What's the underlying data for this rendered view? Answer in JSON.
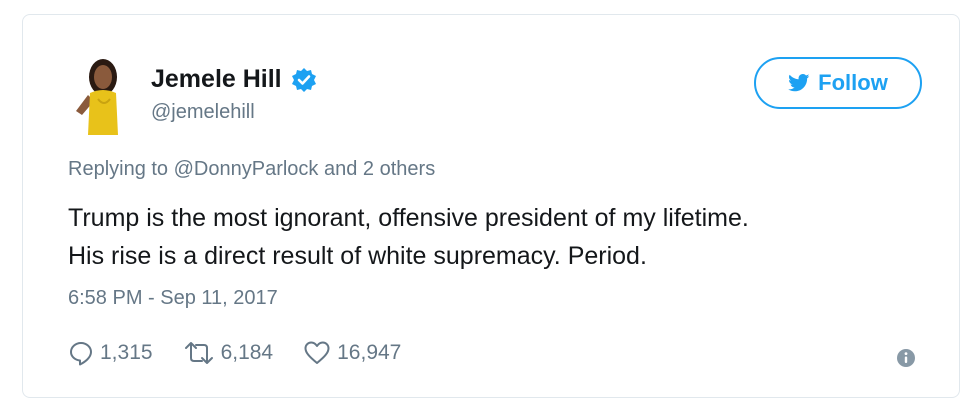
{
  "user": {
    "display_name": "Jemele Hill",
    "handle": "@jemelehill",
    "verified_icon": "verified-badge-icon"
  },
  "follow_button": {
    "label": "Follow",
    "icon": "twitter-bird-icon"
  },
  "reply_context": {
    "prefix": "Replying to",
    "mention": "@DonnyParlock",
    "suffix": "and 2 others"
  },
  "tweet": {
    "line1": "Trump is the most ignorant, offensive president of my lifetime.",
    "line2": "His rise is a direct result of white supremacy. Period.",
    "timestamp": "6:58 PM - Sep 11, 2017"
  },
  "actions": {
    "replies": "1,315",
    "retweets": "6,184",
    "likes": "16,947"
  },
  "colors": {
    "brand_blue": "#1da1f2",
    "secondary_text": "#657786",
    "primary_text": "#14171a"
  }
}
